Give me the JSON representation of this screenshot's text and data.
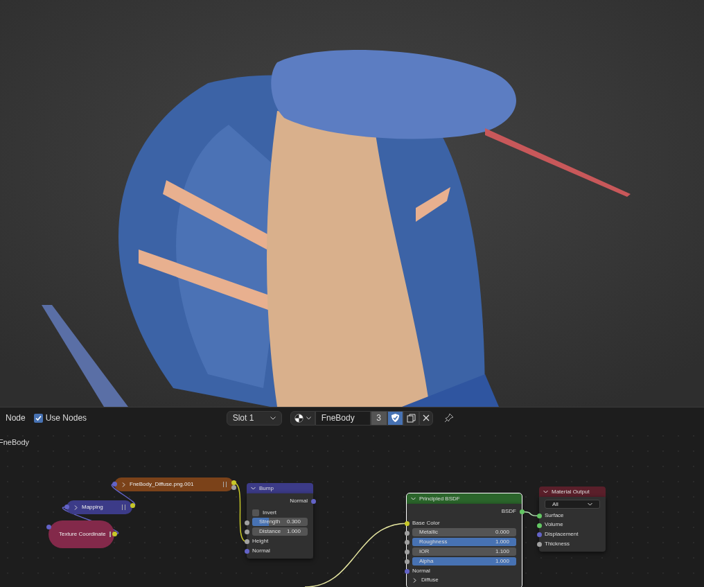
{
  "header": {
    "menu": "Node",
    "use_nodes": {
      "label": "Use Nodes",
      "checked": true
    },
    "slot": "Slot 1",
    "material": {
      "name": "FneBody",
      "users": "3",
      "fake_user": true
    }
  },
  "breadcrumb": "FneBody",
  "nodes": [
    {
      "title": "FneBody_Diffuse.png.001",
      "color": "#7b4219",
      "collapsed": true,
      "selected": false
    },
    {
      "title": "Mapping",
      "color": "#3c3b88",
      "collapsed": true,
      "selected": false
    },
    {
      "title": "Texture Coordinate",
      "color": "#83294a",
      "collapsed": true,
      "selected": false
    },
    {
      "title": "Bump",
      "color": "#3c3b88",
      "collapsed": false,
      "selected": false,
      "rows": [
        {
          "kind": "output",
          "label": "Normal",
          "color": "#6363c7"
        },
        {
          "kind": "checkbox",
          "label": "Invert",
          "checked": false
        },
        {
          "kind": "factor",
          "label": "Strength",
          "value": "0.300",
          "level": 0.3,
          "color": "#a1a1a1"
        },
        {
          "kind": "number",
          "label": "Distance",
          "value": "1.000",
          "color": "#a1a1a1"
        },
        {
          "kind": "input",
          "label": "Height",
          "color": "#a1a1a1"
        },
        {
          "kind": "input",
          "label": "Normal",
          "color": "#6363c7"
        }
      ]
    },
    {
      "title": "Principled BSDF",
      "color": "#2b652b",
      "collapsed": false,
      "selected": true,
      "rows": [
        {
          "kind": "output",
          "label": "BSDF",
          "color": "#63c763"
        },
        {
          "kind": "input",
          "label": "Base Color",
          "color": "#c7c729"
        },
        {
          "kind": "factor",
          "label": "Metallic",
          "value": "0.000",
          "level": 0,
          "color": "#a1a1a1"
        },
        {
          "kind": "factor",
          "label": "Roughness",
          "value": "1.000",
          "level": 1,
          "color": "#a1a1a1"
        },
        {
          "kind": "number",
          "label": "IOR",
          "value": "1.100",
          "color": "#a1a1a1"
        },
        {
          "kind": "factor",
          "label": "Alpha",
          "value": "1.000",
          "level": 1,
          "color": "#a1a1a1"
        },
        {
          "kind": "input",
          "label": "Normal",
          "color": "#6363c7"
        },
        {
          "kind": "panel",
          "label": "Diffuse"
        }
      ]
    },
    {
      "title": "Material Output",
      "color": "#5a1f2a",
      "collapsed": false,
      "selected": false,
      "rows": [
        {
          "kind": "dropdown",
          "value": "All"
        },
        {
          "kind": "input",
          "label": "Surface",
          "color": "#63c763"
        },
        {
          "kind": "input",
          "label": "Volume",
          "color": "#63c763"
        },
        {
          "kind": "input",
          "label": "Displacement",
          "color": "#6363c7"
        },
        {
          "kind": "input",
          "label": "Thickness",
          "color": "#a1a1a1"
        }
      ]
    }
  ]
}
